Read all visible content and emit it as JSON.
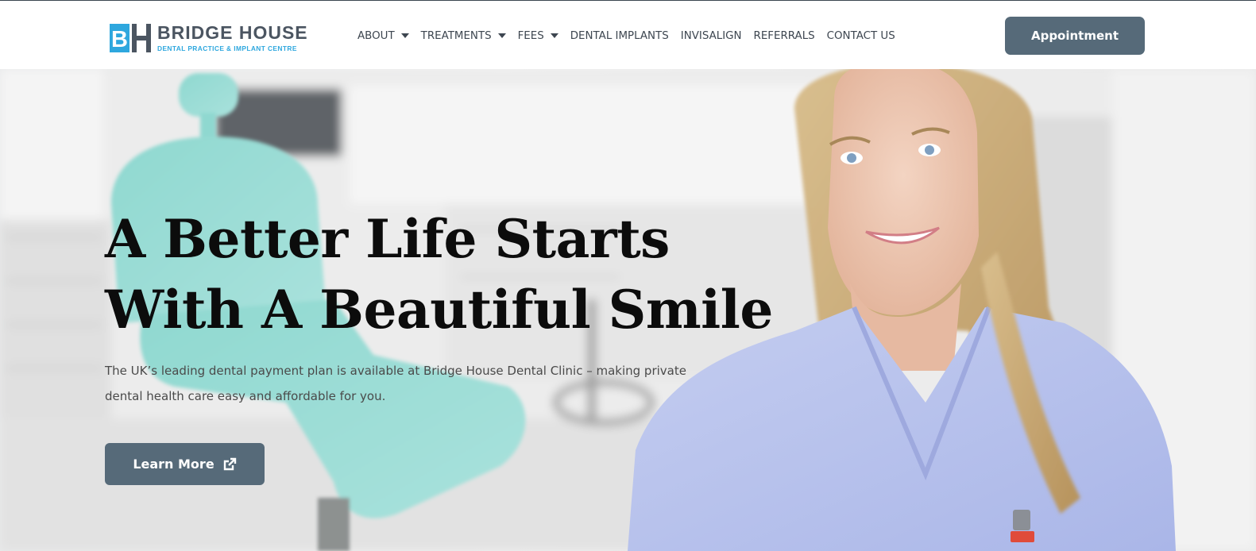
{
  "brand": {
    "name": "BRIDGE HOUSE",
    "tagline": "DENTAL PRACTICE & IMPLANT CENTRE",
    "mark_letters": "BH",
    "color_primary": "#2ea7de",
    "color_text": "#4b5561"
  },
  "nav": {
    "items": [
      {
        "label": "ABOUT",
        "has_dropdown": true
      },
      {
        "label": "TREATMENTS",
        "has_dropdown": true
      },
      {
        "label": "FEES",
        "has_dropdown": true
      },
      {
        "label": "DENTAL IMPLANTS",
        "has_dropdown": false
      },
      {
        "label": "INVISALIGN",
        "has_dropdown": false
      },
      {
        "label": "REFERRALS",
        "has_dropdown": false
      },
      {
        "label": "CONTACT US",
        "has_dropdown": false
      }
    ],
    "dropdown_icon": "caret-down-icon",
    "appointment_label": "Appointment"
  },
  "hero": {
    "title_line1": "A Better Life Starts",
    "title_line2": "With A Beautiful Smile",
    "description": "The UK’s leading dental payment plan is available at Bridge House Dental Clinic – making private dental health care easy and affordable for you.",
    "cta_label": "Learn More",
    "cta_icon": "external-link-icon"
  },
  "colors": {
    "button_bg": "#566a79",
    "button_text": "#ffffff",
    "heading": "#0c0c0c",
    "body_text": "#4a4a4a"
  }
}
